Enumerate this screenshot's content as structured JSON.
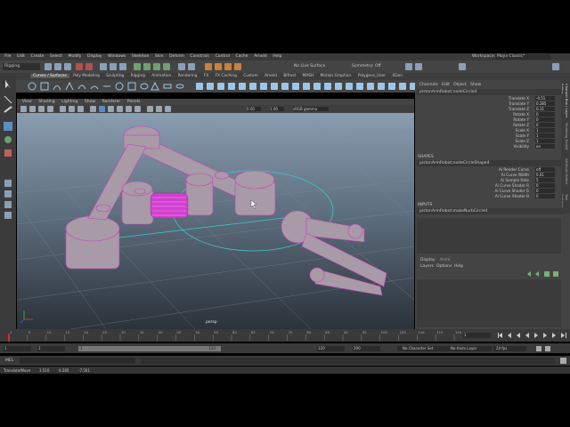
{
  "menu": [
    "File",
    "Edit",
    "Create",
    "Select",
    "Modify",
    "Display",
    "Windows",
    "Skeleton",
    "Skin",
    "Deform",
    "Constrain",
    "Control",
    "Cache",
    "Arnold",
    "Help"
  ],
  "workspace": {
    "label": "Workspace:",
    "value": "Maya Classic*"
  },
  "mode_menu": "Rigging",
  "status_line": {
    "live_surface": "No Live Surface",
    "symmetry": "Symmetry: Off"
  },
  "shelf_tabs": [
    "Curves / Surfaces",
    "Poly Modeling",
    "Sculpting",
    "Rigging",
    "Animation",
    "Rendering",
    "FX",
    "FX Caching",
    "Custom",
    "Arnold",
    "Bifrost",
    "MASH",
    "Motion Graphics",
    "Polygons_User",
    "XGen"
  ],
  "panel_menu": [
    "View",
    "Shading",
    "Lighting",
    "Show",
    "Renderer",
    "Panels"
  ],
  "panel_tools": {
    "value_a": "0.00",
    "value_b": "1.00",
    "color_space": "sRGB gamma"
  },
  "viewport_label": "persp",
  "channel_box": {
    "menu": [
      "Channels",
      "Edit",
      "Object",
      "Show"
    ],
    "object_name": "pistonArmRobot:nodeCircle4",
    "attributes": [
      {
        "name": "Translate X",
        "value": "-0.51"
      },
      {
        "name": "Translate Y",
        "value": "0.285"
      },
      {
        "name": "Translate Z",
        "value": "0.11"
      },
      {
        "name": "Rotate X",
        "value": "0"
      },
      {
        "name": "Rotate Y",
        "value": "0"
      },
      {
        "name": "Rotate Z",
        "value": "0"
      },
      {
        "name": "Scale X",
        "value": "1"
      },
      {
        "name": "Scale Y",
        "value": "1"
      },
      {
        "name": "Scale Z",
        "value": "1"
      },
      {
        "name": "Visibility",
        "value": "on"
      }
    ],
    "shapes_header": "SHAPES",
    "shape_name": "pistonArmRobot:nodeCircleShape4",
    "shape_attributes": [
      {
        "name": "Ai Render Curve",
        "value": "off"
      },
      {
        "name": "Ai Curve Width",
        "value": "0.01"
      },
      {
        "name": "Ai Sample Rate",
        "value": "5"
      },
      {
        "name": "Ai Curve Shader R",
        "value": "0"
      },
      {
        "name": "Ai Curve Shader G",
        "value": "0"
      },
      {
        "name": "Ai Curve Shader B",
        "value": "0"
      }
    ],
    "inputs_header": "INPUTS",
    "input_name": "pistonArmRobot:makeNurbCircle4"
  },
  "layer_editor": {
    "tabs": [
      "Display",
      "Anim"
    ],
    "menu": [
      "Layers",
      "Options",
      "Help"
    ]
  },
  "side_tabs": [
    "Channel Box / Layer Editor",
    "Modeling Toolkit",
    "Attribute Editor",
    "Tool Settings"
  ],
  "time_ticks": [
    "1",
    "5",
    "10",
    "15",
    "20",
    "25",
    "30",
    "35",
    "40",
    "45",
    "50",
    "55",
    "60",
    "65",
    "70",
    "75",
    "80",
    "85",
    "90",
    "95",
    "100",
    "105",
    "110",
    "115",
    "120"
  ],
  "current_frame": "1",
  "range": {
    "start": "1",
    "inner_start": "1",
    "inner_end": "120",
    "end": "120",
    "anim_end": "200",
    "character_set": "No Character Set",
    "anim_layer": "No Anim Layer",
    "fps": "24 fps"
  },
  "command_line": {
    "label": "MEL"
  },
  "help_line": {
    "text": "Translate/Move",
    "x": "3.510",
    "y": "0.285",
    "z": "-7.561"
  },
  "colors": {
    "accent": "#5d8cc4",
    "mesh_face": "#a08a9a",
    "mesh_wire": "#cc3fbf",
    "nurbs": "#3fc8c8",
    "timeline_marker": "#c83030"
  }
}
